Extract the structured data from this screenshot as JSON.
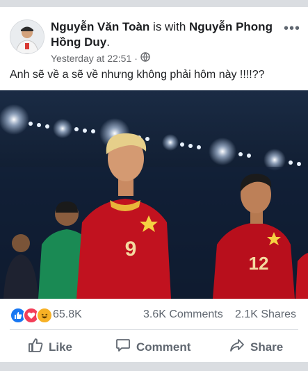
{
  "post": {
    "author": "Nguyễn Văn Toàn",
    "with_text": "is with",
    "tagged": "Nguyễn Phong Hồng Duy",
    "tagged_suffix": ".",
    "timestamp": "Yesterday at 22:51",
    "separator": "·",
    "privacy_icon": "globe-icon",
    "more_icon": "more-options-icon",
    "more_glyph": "•••",
    "text": "Anh sẽ về a sẽ về nhưng không phải hôm này !!!!??"
  },
  "photo": {
    "jersey_left_number": "9",
    "jersey_right_number": "12"
  },
  "stats": {
    "reaction_icons": [
      "like-reaction-icon",
      "love-reaction-icon",
      "haha-reaction-icon"
    ],
    "reactions": "65.8K",
    "comments": "3.6K Comments",
    "shares": "2.1K Shares"
  },
  "actions": {
    "like": "Like",
    "comment": "Comment",
    "share": "Share"
  },
  "colors": {
    "facebook_blue": "#1877f2",
    "love_red": "#f33e58",
    "haha_yellow": "#f7b125",
    "jersey_red": "#c1121f"
  }
}
